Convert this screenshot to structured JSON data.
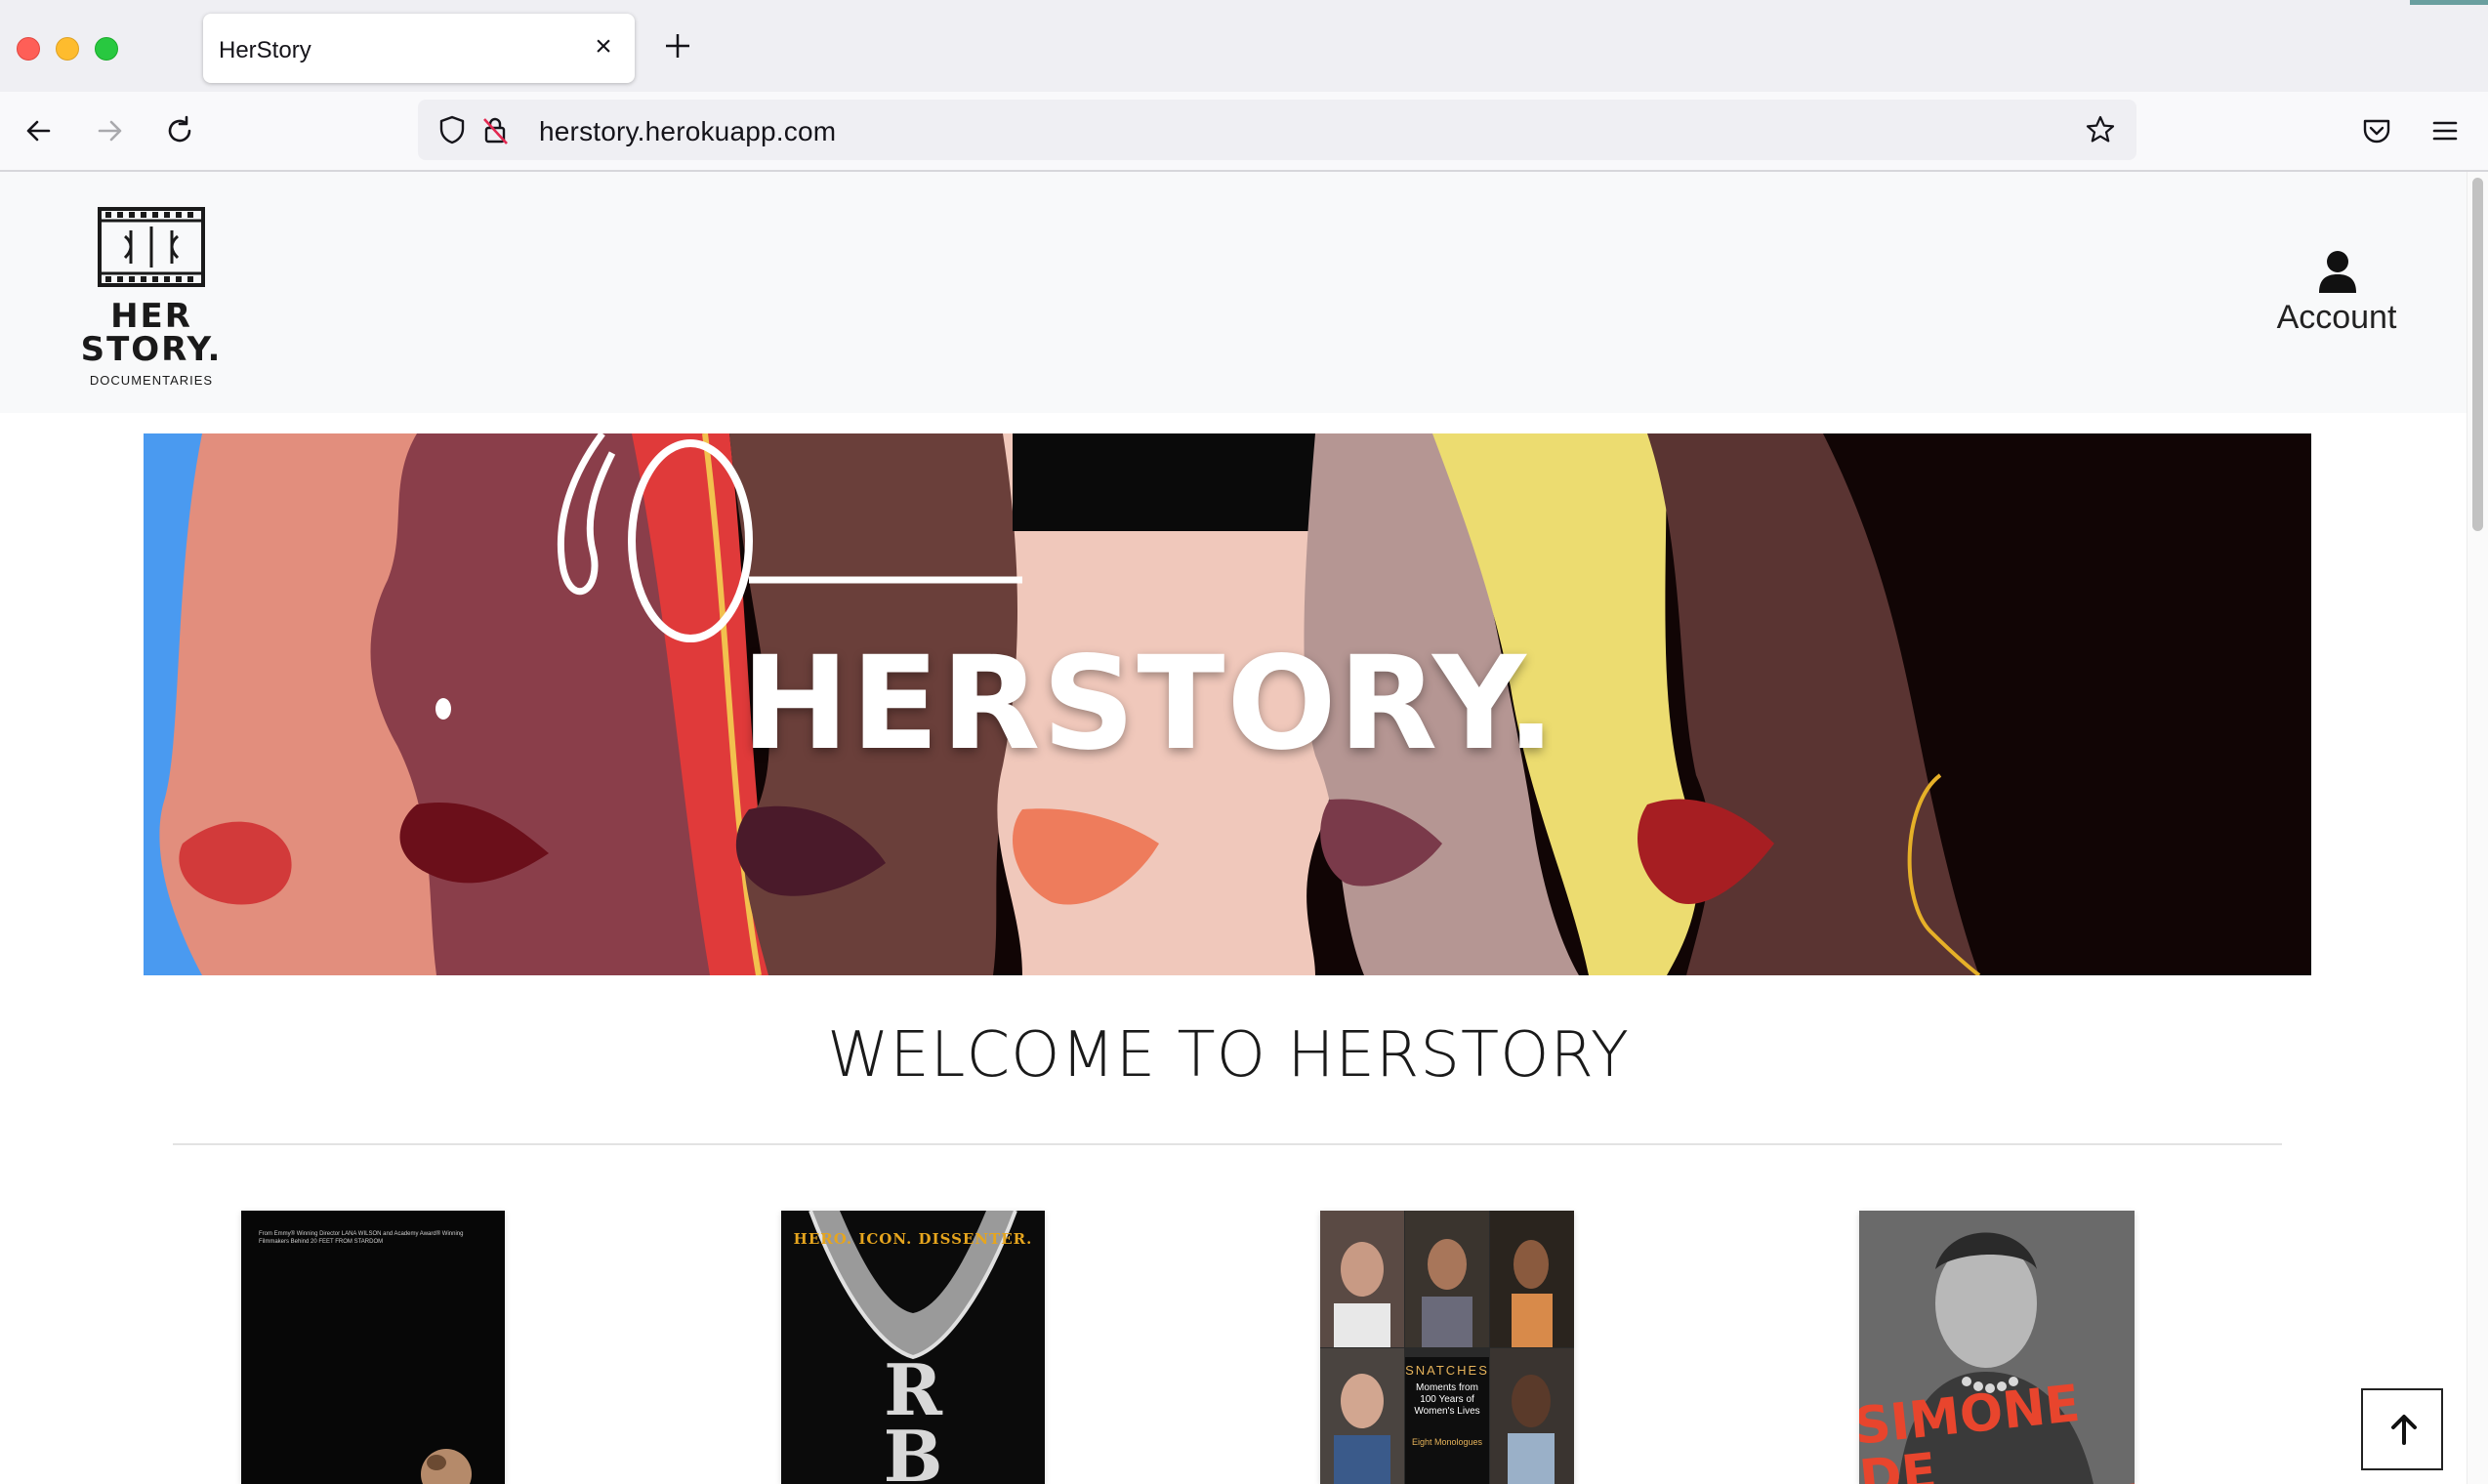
{
  "browser": {
    "tab_title": "HerStory",
    "url": "herstory.herokuapp.com"
  },
  "header": {
    "logo": {
      "line1": "HER",
      "line2": "STORY.",
      "subtitle": "DOCUMENTARIES"
    },
    "account_label": "Account"
  },
  "hero": {
    "title": "HERSTORY."
  },
  "welcome": {
    "heading": "WELCOME TO HERSTORY"
  },
  "posters": [
    {
      "tagline": "From Emmy® Winning Director LANA WILSON and Academy Award® Winning Filmmakers Behind 20 FEET FROM STARDOM"
    },
    {
      "tagline": "HERO. ICON. DISSENTER.",
      "letters": "R\nB"
    },
    {
      "title": "SNATCHES",
      "subtitle": "Moments from 100 Years of Women's Lives",
      "footer": "Eight Monologues"
    },
    {
      "name": "SIMONE\nDE BEAUVOIR"
    }
  ],
  "colors": {
    "header_bg": "#f8f9fa",
    "hero_blue": "#4a9af0",
    "hero_red": "#e03a3a",
    "hero_yellow": "#ecdc70",
    "poster_accent": "#e8452d"
  },
  "icons": [
    "back-icon",
    "forward-icon",
    "reload-icon",
    "shield-icon",
    "insecure-lock-icon",
    "bookmark-star-icon",
    "pocket-icon",
    "menu-icon",
    "close-icon",
    "plus-icon",
    "user-icon",
    "arrow-up-icon"
  ]
}
